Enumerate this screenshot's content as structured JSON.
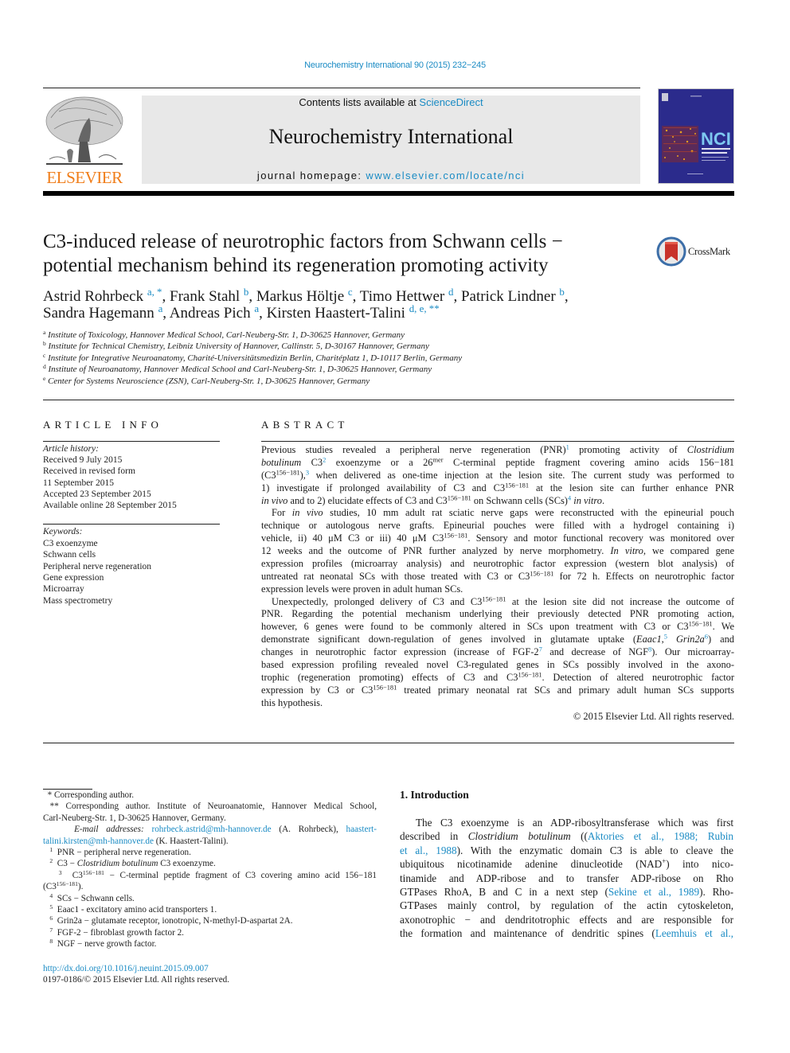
{
  "header": {
    "citation": "Neurochemistry International 90 (2015) 232−245",
    "contents_prefix": "Contents lists available at ",
    "contents_link": "ScienceDirect",
    "journal_name": "Neurochemistry International",
    "homepage_prefix": "journal homepage: ",
    "homepage_link": "www.elsevier.com/locate/nci",
    "publisher_wordmark": "ELSEVIER",
    "cover_label": "NCI",
    "crossmark_label": "CrossMark",
    "colors": {
      "link": "#1a8bc4",
      "elsevier_orange": "#f07d19",
      "cover_blue": "#2a2a8a",
      "crossmark_red": "#c8322a"
    }
  },
  "article": {
    "title_lines": [
      "C3-induced release of neurotrophic factors from Schwann cells −",
      "potential mechanism behind its regeneration promoting activity"
    ],
    "author_lines": [
      [
        {
          "t": "Astrid Rohrbeck "
        },
        {
          "sup": "a, *"
        },
        {
          "t": ", Frank Stahl "
        },
        {
          "sup": "b"
        },
        {
          "t": ", Markus Höltje "
        },
        {
          "sup": "c"
        },
        {
          "t": ", Timo Hettwer "
        },
        {
          "sup": "d"
        },
        {
          "t": ", Patrick Lindner "
        },
        {
          "sup": "b"
        },
        {
          "t": ","
        }
      ],
      [
        {
          "t": "Sandra Hagemann "
        },
        {
          "sup": "a"
        },
        {
          "t": ", Andreas Pich "
        },
        {
          "sup": "a"
        },
        {
          "t": ", Kirsten Haastert-Talini "
        },
        {
          "sup": "d, e, **"
        }
      ]
    ],
    "affiliations": [
      {
        "key": "a",
        "text": "Institute of Toxicology, Hannover Medical School, Carl-Neuberg-Str. 1, D-30625 Hannover, Germany"
      },
      {
        "key": "b",
        "text": "Institute for Technical Chemistry, Leibniz University of Hannover, Callinstr. 5, D-30167 Hannover, Germany"
      },
      {
        "key": "c",
        "text": "Institute for Integrative Neuroanatomy, Charité-Universitätsmedizin Berlin, Charitéplatz 1, D-10117 Berlin, Germany"
      },
      {
        "key": "d",
        "text": "Institute of Neuroanatomy, Hannover Medical School and Carl-Neuberg-Str. 1, D-30625 Hannover, Germany"
      },
      {
        "key": "e",
        "text": "Center for Systems Neuroscience (ZSN), Carl-Neuberg-Str. 1, D-30625 Hannover, Germany"
      }
    ]
  },
  "article_info": {
    "heading": "ARTICLE INFO",
    "history_label": "Article history:",
    "history": [
      "Received 9 July 2015",
      "Received in revised form",
      "11 September 2015",
      "Accepted 23 September 2015",
      "Available online 28 September 2015"
    ],
    "keywords_label": "Keywords:",
    "keywords": [
      "C3 exoenzyme",
      "Schwann cells",
      "Peripheral nerve regeneration",
      "Gene expression",
      "Microarray",
      "Mass spectrometry"
    ]
  },
  "abstract": {
    "heading": "ABSTRACT",
    "lines": [
      {
        "segs": [
          {
            "t": "Previous studies revealed a peripheral nerve regeneration (PNR)"
          },
          {
            "supb": "1"
          },
          {
            "t": " promoting activity of "
          },
          {
            "i": "Clostridium"
          }
        ]
      },
      {
        "segs": [
          {
            "i": "botulinum"
          },
          {
            "t": " C3"
          },
          {
            "supb": "2"
          },
          {
            "t": " exoenzyme or a 26"
          },
          {
            "sup": "mer"
          },
          {
            "t": " C-terminal peptide fragment covering amino acids 156−181"
          }
        ]
      },
      {
        "segs": [
          {
            "t": "(C3"
          },
          {
            "sup": "156−181"
          },
          {
            "t": "),"
          },
          {
            "supb": "3"
          },
          {
            "t": " when delivered as one-time injection at the lesion site. The current study was performed to"
          }
        ]
      },
      {
        "segs": [
          {
            "t": "1) investigate if prolonged availability of C3 and C3"
          },
          {
            "sup": "156−181"
          },
          {
            "t": " at the lesion site can further enhance PNR"
          }
        ]
      },
      {
        "last": true,
        "segs": [
          {
            "i": "in vivo"
          },
          {
            "t": " and to 2) elucidate effects of C3 and C3"
          },
          {
            "sup": "156−181"
          },
          {
            "t": " on Schwann cells (SCs)"
          },
          {
            "supb": "4"
          },
          {
            "t": " "
          },
          {
            "i": "in vitro"
          },
          {
            "t": "."
          }
        ]
      },
      {
        "indent": true,
        "segs": [
          {
            "t": "For "
          },
          {
            "i": "in vivo"
          },
          {
            "t": " studies, 10 mm adult rat sciatic nerve gaps were reconstructed with the epineurial pouch"
          }
        ]
      },
      {
        "segs": [
          {
            "t": "technique or autologous nerve grafts. Epineurial pouches were filled with a hydrogel containing i)"
          }
        ]
      },
      {
        "segs": [
          {
            "t": "vehicle, ii) 40 μM C3 or iii) 40 μM C3"
          },
          {
            "sup": "156−181"
          },
          {
            "t": ". Sensory and motor functional recovery was monitored over"
          }
        ]
      },
      {
        "segs": [
          {
            "t": "12 weeks and the outcome of PNR further analyzed by nerve morphometry. "
          },
          {
            "i": "In vitro"
          },
          {
            "t": ", we compared gene"
          }
        ]
      },
      {
        "segs": [
          {
            "t": "expression profiles (microarray analysis) and neurotrophic factor expression (western blot analysis) of"
          }
        ]
      },
      {
        "segs": [
          {
            "t": "untreated rat neonatal SCs with those treated with C3 or C3"
          },
          {
            "sup": "156−181"
          },
          {
            "t": " for 72 h. Effects on neurotrophic factor"
          }
        ]
      },
      {
        "last": true,
        "segs": [
          {
            "t": "expression levels were proven in adult human SCs."
          }
        ]
      },
      {
        "indent": true,
        "segs": [
          {
            "t": "Unexpectedly, prolonged delivery of C3 and C3"
          },
          {
            "sup": "156−181"
          },
          {
            "t": " at the lesion site did not increase the outcome of"
          }
        ]
      },
      {
        "segs": [
          {
            "t": "PNR. Regarding the potential mechanism underlying their previously detected PNR promoting action,"
          }
        ]
      },
      {
        "segs": [
          {
            "t": "however, 6 genes were found to be commonly altered in SCs upon treatment with C3 or C3"
          },
          {
            "sup": "156−181"
          },
          {
            "t": ". We"
          }
        ]
      },
      {
        "segs": [
          {
            "t": "demonstrate significant down-regulation of genes involved in glutamate uptake ("
          },
          {
            "i": "Eaac1,"
          },
          {
            "supb": "5"
          },
          {
            "t": " "
          },
          {
            "i": "Grin2a"
          },
          {
            "supb": "6"
          },
          {
            "t": ") and"
          }
        ]
      },
      {
        "segs": [
          {
            "t": "changes in neurotrophic factor expression (increase of FGF-2"
          },
          {
            "supb": "7"
          },
          {
            "t": " and decrease of NGF"
          },
          {
            "supb": "8"
          },
          {
            "t": "). Our microarray-"
          }
        ]
      },
      {
        "segs": [
          {
            "t": "based expression profiling revealed novel C3-regulated genes in SCs possibly involved in the axono-"
          }
        ]
      },
      {
        "segs": [
          {
            "t": "trophic (regeneration promoting) effects of C3 and C3"
          },
          {
            "sup": "156−181"
          },
          {
            "t": ". Detection of altered neurotrophic factor"
          }
        ]
      },
      {
        "segs": [
          {
            "t": "expression by C3 or C3"
          },
          {
            "sup": "156−181"
          },
          {
            "t": " treated primary neonatal rat SCs and primary adult human SCs supports"
          }
        ]
      },
      {
        "last": true,
        "segs": [
          {
            "t": "this hypothesis."
          }
        ]
      }
    ],
    "copyright": "© 2015 Elsevier Ltd. All rights reserved."
  },
  "footnotes": {
    "lines": [
      {
        "segs": [
          {
            "t": "  * Corresponding author."
          }
        ],
        "last": true
      },
      {
        "segs": [
          {
            "t": " ** Corresponding author. Institute of Neuroanatomie, Hannover Medical School,"
          }
        ]
      },
      {
        "segs": [
          {
            "t": "Carl-Neuberg-Str. 1, D-30625 Hannover, Germany."
          }
        ],
        "last": true
      },
      {
        "segs": [
          {
            "t": "    "
          },
          {
            "i": "E-mail addresses:"
          },
          {
            "t": " "
          },
          {
            "a": "rohrbeck.astrid@mh-hannover.de"
          },
          {
            "t": " (A. Rohrbeck), "
          },
          {
            "a": "haastert-"
          }
        ]
      },
      {
        "segs": [
          {
            "a": "talini.kirsten@mh-hannover.de"
          },
          {
            "t": " (K. Haastert-Talini)."
          }
        ],
        "last": true
      },
      {
        "segs": [
          {
            "t": "   "
          },
          {
            "sup": "1"
          },
          {
            "t": "  PNR − peripheral nerve regeneration."
          }
        ],
        "last": true
      },
      {
        "segs": [
          {
            "t": "   "
          },
          {
            "sup": "2"
          },
          {
            "t": "  C3 − "
          },
          {
            "i": "Clostridium botulinum"
          },
          {
            "t": " C3 exoenzyme."
          }
        ],
        "last": true
      },
      {
        "segs": [
          {
            "t": "   "
          },
          {
            "sup": "3"
          },
          {
            "t": "  C3"
          },
          {
            "sup": "156−181"
          },
          {
            "t": " − C-terminal peptide fragment of C3 covering amino acid 156−181"
          }
        ]
      },
      {
        "segs": [
          {
            "t": "(C3"
          },
          {
            "sup": "156−181"
          },
          {
            "t": ")."
          }
        ],
        "last": true
      },
      {
        "segs": [
          {
            "t": "   "
          },
          {
            "sup": "4"
          },
          {
            "t": "  SCs − Schwann cells."
          }
        ],
        "last": true
      },
      {
        "segs": [
          {
            "t": "   "
          },
          {
            "sup": "5"
          },
          {
            "t": "  Eaac1 - excitatory amino acid transporters 1."
          }
        ],
        "last": true
      },
      {
        "segs": [
          {
            "t": "   "
          },
          {
            "sup": "6"
          },
          {
            "t": "  Grin2a − glutamate receptor, ionotropic, N-methyl-D-aspartat 2A."
          }
        ],
        "last": true
      },
      {
        "segs": [
          {
            "t": "   "
          },
          {
            "sup": "7"
          },
          {
            "t": "  FGF-2 − fibroblast growth factor 2."
          }
        ],
        "last": true
      },
      {
        "segs": [
          {
            "t": "   "
          },
          {
            "sup": "8"
          },
          {
            "t": "  NGF − nerve growth factor."
          }
        ],
        "last": true
      }
    ],
    "doi": "http://dx.doi.org/10.1016/j.neuint.2015.09.007",
    "issn_copyright": "0197-0186/© 2015 Elsevier Ltd. All rights reserved."
  },
  "introduction": {
    "heading": "1.  Introduction",
    "lines": [
      {
        "indent": true,
        "segs": [
          {
            "t": "The C3 exoenzyme is an ADP-ribosyltransferase which was first"
          }
        ]
      },
      {
        "segs": [
          {
            "t": "described in "
          },
          {
            "i": "Clostridium botulinum"
          },
          {
            "t": " (("
          },
          {
            "a": "Aktories et al., 1988; Rubin"
          }
        ]
      },
      {
        "segs": [
          {
            "a": "et al., 1988"
          },
          {
            "t": "). With the enzymatic domain C3 is able to cleave the"
          }
        ]
      },
      {
        "segs": [
          {
            "t": "ubiquitous nicotinamide adenine dinucleotide (NAD"
          },
          {
            "sup": "+"
          },
          {
            "t": ") into nico-"
          }
        ]
      },
      {
        "segs": [
          {
            "t": "tinamide and ADP-ribose and to transfer ADP-ribose on Rho"
          }
        ]
      },
      {
        "segs": [
          {
            "t": "GTPases RhoA, B and C in a next step ("
          },
          {
            "a": "Sekine et al., 1989"
          },
          {
            "t": "). Rho-"
          }
        ]
      },
      {
        "segs": [
          {
            "t": "GTPases mainly control, by regulation of the actin cytoskeleton,"
          }
        ]
      },
      {
        "segs": [
          {
            "t": "axonotrophic − and dendritotrophic effects and are responsible for"
          }
        ]
      },
      {
        "segs": [
          {
            "t": "the formation and maintenance of dendritic spines ("
          },
          {
            "a": "Leemhuis et al.,"
          }
        ]
      }
    ]
  }
}
